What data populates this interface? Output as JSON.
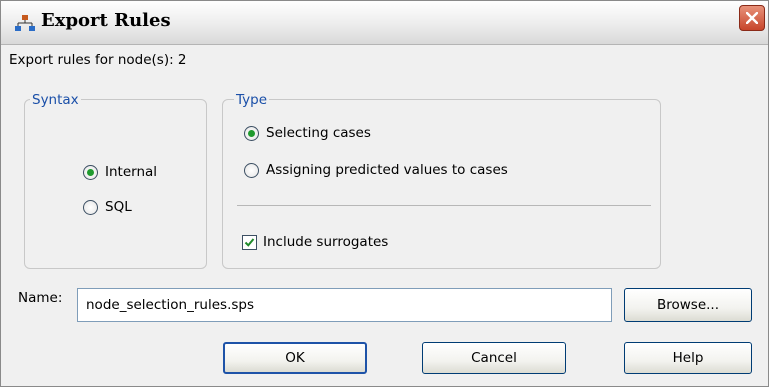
{
  "window": {
    "title": "Export Rules"
  },
  "header_text": "Export rules for node(s): 2",
  "syntax": {
    "legend": "Syntax",
    "options": [
      {
        "label": "Internal",
        "selected": true
      },
      {
        "label": "SQL",
        "selected": false
      }
    ]
  },
  "type": {
    "legend": "Type",
    "options": [
      {
        "label": "Selecting cases",
        "selected": true
      },
      {
        "label": "Assigning predicted values to cases",
        "selected": false
      }
    ],
    "include_surrogates": {
      "label": "Include surrogates",
      "checked": true
    }
  },
  "name": {
    "label": "Name:",
    "value": "node_selection_rules.sps"
  },
  "buttons": {
    "browse": "Browse...",
    "ok": "OK",
    "cancel": "Cancel",
    "help": "Help"
  },
  "colors": {
    "legend": "#1a4fa8",
    "radio_dot": "#1f9a2e",
    "check": "#1f8a2a",
    "close": "#c7452b"
  }
}
